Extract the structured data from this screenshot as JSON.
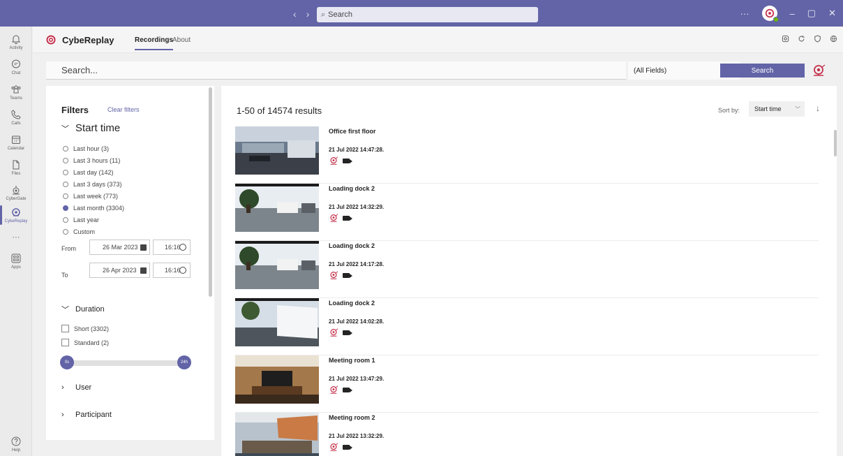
{
  "titlebar": {
    "search_placeholder": "Search",
    "more": "···",
    "minimize": "–",
    "restore": "▢",
    "close": "✕"
  },
  "rail": [
    {
      "label": "Activity",
      "icon": "bell-icon"
    },
    {
      "label": "Chat",
      "icon": "chat-icon"
    },
    {
      "label": "Teams",
      "icon": "teams-icon"
    },
    {
      "label": "Calls",
      "icon": "phone-icon"
    },
    {
      "label": "Calendar",
      "icon": "calendar-icon"
    },
    {
      "label": "Files",
      "icon": "file-icon"
    },
    {
      "label": "CyberGate",
      "icon": "cybergate-icon"
    },
    {
      "label": "CybeReplay",
      "icon": "cybereplay-icon",
      "active": true
    },
    {
      "label": "···",
      "icon": "more-icon"
    },
    {
      "label": "Apps",
      "icon": "apps-icon"
    }
  ],
  "help_label": "Help",
  "app": {
    "name": "CybeReplay",
    "tabs": [
      {
        "label": "Recordings",
        "active": true
      },
      {
        "label": "About"
      }
    ]
  },
  "search": {
    "placeholder": "Search...",
    "field_select": "(All Fields)",
    "button": "Search"
  },
  "filters": {
    "title": "Filters",
    "clear": "Clear filters",
    "start_time": {
      "heading": "Start time",
      "options": [
        {
          "label": "Last hour (3)"
        },
        {
          "label": "Last 3 hours (11)"
        },
        {
          "label": "Last day (142)"
        },
        {
          "label": "Last 3 days (373)"
        },
        {
          "label": "Last week (773)"
        },
        {
          "label": "Last month (3304)",
          "selected": true
        },
        {
          "label": "Last year"
        },
        {
          "label": "Custom"
        }
      ],
      "from_label": "From",
      "to_label": "To",
      "from_date": "26 Mar 2023",
      "from_time": "16:16",
      "to_date": "26 Apr 2023",
      "to_time": "16:16"
    },
    "duration": {
      "heading": "Duration",
      "options": [
        {
          "label": "Short (3302)"
        },
        {
          "label": "Standard (2)"
        }
      ],
      "slider_min": "0s",
      "slider_max": "24h"
    },
    "user_heading": "User",
    "participant_heading": "Participant"
  },
  "results": {
    "count": "1-50 of 14574 results",
    "sort_label": "Sort by:",
    "sort_value": "Start time",
    "sort_direction": "↓",
    "items": [
      {
        "title": "Office first floor",
        "time": "21 Jul 2022 14:47:28.",
        "scene": "office"
      },
      {
        "title": "Loading dock 2",
        "time": "21 Jul 2022 14:32:29.",
        "scene": "dock"
      },
      {
        "title": "Loading dock 2",
        "time": "21 Jul 2022 14:17:28.",
        "scene": "dock"
      },
      {
        "title": "Loading dock 2",
        "time": "21 Jul 2022 14:02:28.",
        "scene": "dock2"
      },
      {
        "title": "Meeting room 1",
        "time": "21 Jul 2022 13:47:29.",
        "scene": "meeting"
      },
      {
        "title": "Meeting room 2",
        "time": "21 Jul 2022 13:32:29.",
        "scene": "meeting2"
      }
    ]
  },
  "colors": {
    "accent": "#6264a7",
    "brand_red": "#c4314b"
  }
}
